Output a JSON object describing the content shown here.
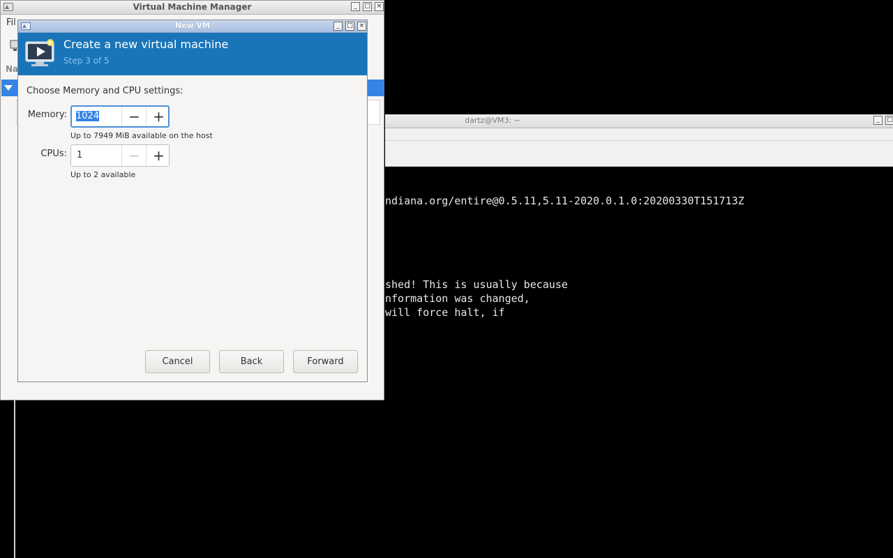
{
  "terminal": {
    "title": "dartz@VM3: ~",
    "lines": [
      "ndiana.org/entire@0.5.11,5.11-2020.0.1.0:20200330T151713Z",
      "shed! This is usually because",
      "nformation was changed,",
      "will force halt, if"
    ]
  },
  "vmm": {
    "title": "Virtual Machine Manager",
    "menu_partial": "Fil",
    "column_partial": "Na"
  },
  "dialog": {
    "title": "New VM",
    "header_title": "Create a new virtual machine",
    "step": "Step 3 of 5",
    "heading": "Choose Memory and CPU settings:",
    "memory_label": "Memory:",
    "memory_value": "1024",
    "memory_hint": "Up to 7949 MiB available on the host",
    "cpus_label": "CPUs:",
    "cpus_value": "1",
    "cpus_hint": "Up to 2 available",
    "buttons": {
      "cancel": "Cancel",
      "back": "Back",
      "forward": "Forward"
    }
  },
  "icons": {
    "minimize": "minimize-icon",
    "maximize": "maximize-icon",
    "close": "close-icon",
    "minus": "minus-icon",
    "plus": "plus-icon"
  },
  "colors": {
    "header_blue": "#1a75b8",
    "selection_blue": "#3584e4",
    "focus_border": "#4a90d9"
  }
}
